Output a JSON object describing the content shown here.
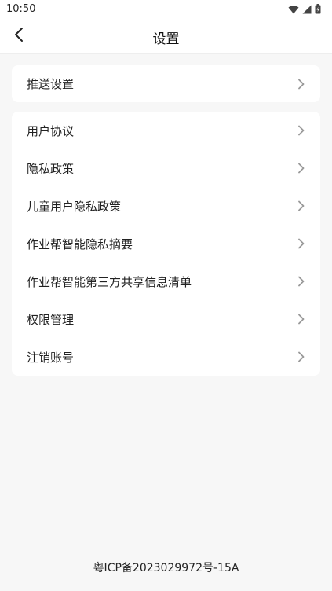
{
  "status_bar": {
    "time": "10:50",
    "icons": [
      "wifi-icon",
      "cellular-signal-icon",
      "battery-icon"
    ]
  },
  "header": {
    "back_icon": "chevron-left-icon",
    "title": "设置"
  },
  "sections": [
    {
      "items": [
        {
          "label": "推送设置"
        }
      ]
    },
    {
      "items": [
        {
          "label": "用户协议"
        },
        {
          "label": "隐私政策"
        },
        {
          "label": "儿童用户隐私政策"
        },
        {
          "label": "作业帮智能隐私摘要"
        },
        {
          "label": "作业帮智能第三方共享信息清单"
        },
        {
          "label": "权限管理"
        },
        {
          "label": "注销账号"
        }
      ]
    }
  ],
  "footer": {
    "icp": "粤ICP备2023029972号-15A"
  },
  "colors": {
    "background": "#f7f7f7",
    "card": "#ffffff",
    "text": "#222222",
    "chevron": "#9a9a9a"
  }
}
